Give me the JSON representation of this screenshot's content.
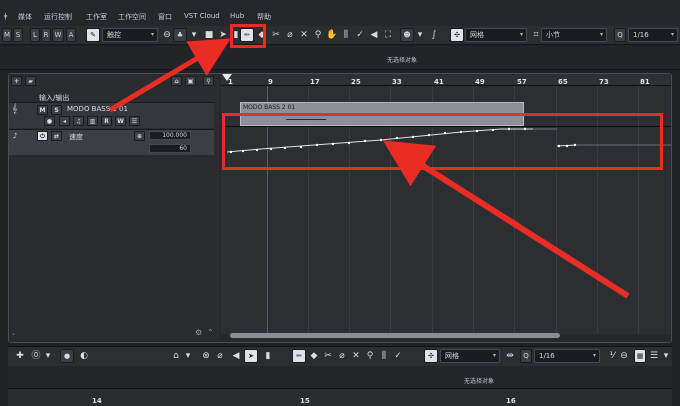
{
  "menu": {
    "items": [
      "媒体",
      "运行控制",
      "工作室",
      "工作空间",
      "窗口",
      "VST Cloud",
      "Hub",
      "帮助"
    ]
  },
  "toolbar": {
    "mode_buttons": [
      "M",
      "S",
      "L",
      "R",
      "W",
      "A"
    ],
    "automation_mode": "触控",
    "snap_type": "网格",
    "grid": "小节",
    "quantize": "1/16"
  },
  "status": {
    "no_selection": "无选择对象"
  },
  "tracklist": {
    "folder_label": "输入/输出",
    "track_name": "MODO BASS 2 01",
    "track_buttons": [
      "M",
      "S",
      "R",
      "W"
    ],
    "automation_param": "速度",
    "automation_value": "100.000",
    "automation_sub": "60"
  },
  "ruler": {
    "marks": [
      "1",
      "9",
      "17",
      "25",
      "33",
      "41",
      "49",
      "57",
      "65",
      "73",
      "81"
    ]
  },
  "event": {
    "name": "MODO BASS 2 01"
  },
  "lower_toolbar": {
    "snap_type": "网格",
    "quantize": "1/16"
  },
  "lower_status": {
    "no_selection": "无选择对象"
  },
  "lower_ruler": {
    "marks": [
      "14",
      "15",
      "16"
    ]
  },
  "colors": {
    "annotation": "#ea2d24",
    "event_fill": "#8d9096"
  }
}
